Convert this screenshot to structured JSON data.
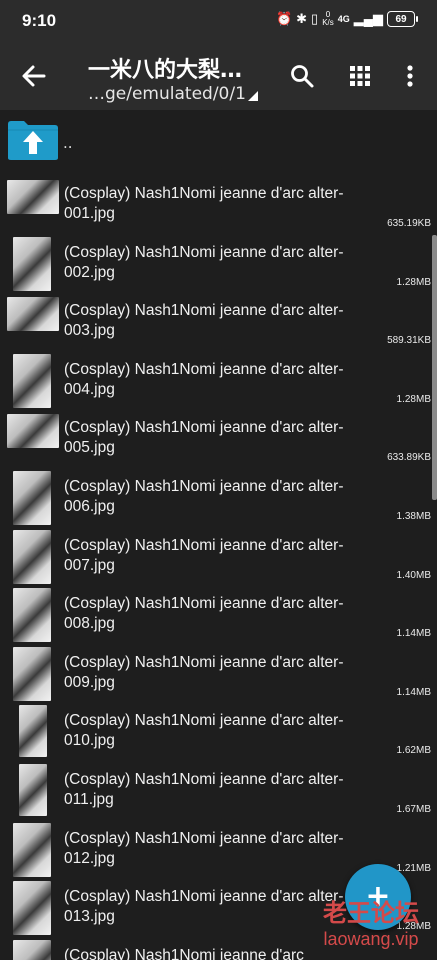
{
  "status_bar": {
    "time": "9:10",
    "net_speed_top": "0",
    "net_speed_bottom": "K/s",
    "signal": "4G",
    "battery": "69"
  },
  "toolbar": {
    "title": "一米八的大梨…",
    "path": "…ge/emulated/0/1"
  },
  "up_item": {
    "label": ".."
  },
  "files": [
    {
      "name": "(Cosplay) Nash1Nomi jeanne d'arc alter-001.jpg",
      "size": "635.19KB",
      "orientation": "landscape"
    },
    {
      "name": "(Cosplay) Nash1Nomi jeanne d'arc alter-002.jpg",
      "size": "1.28MB",
      "orientation": "portrait"
    },
    {
      "name": "(Cosplay) Nash1Nomi jeanne d'arc alter-003.jpg",
      "size": "589.31KB",
      "orientation": "landscape"
    },
    {
      "name": "(Cosplay) Nash1Nomi jeanne d'arc alter-004.jpg",
      "size": "1.28MB",
      "orientation": "portrait"
    },
    {
      "name": "(Cosplay) Nash1Nomi jeanne d'arc alter-005.jpg",
      "size": "633.89KB",
      "orientation": "landscape"
    },
    {
      "name": "(Cosplay) Nash1Nomi jeanne d'arc alter-006.jpg",
      "size": "1.38MB",
      "orientation": "portrait"
    },
    {
      "name": "(Cosplay) Nash1Nomi jeanne d'arc alter-007.jpg",
      "size": "1.40MB",
      "orientation": "portrait"
    },
    {
      "name": "(Cosplay) Nash1Nomi jeanne d'arc alter-008.jpg",
      "size": "1.14MB",
      "orientation": "portrait"
    },
    {
      "name": "(Cosplay) Nash1Nomi jeanne d'arc alter-009.jpg",
      "size": "1.14MB",
      "orientation": "portrait"
    },
    {
      "name": "(Cosplay) Nash1Nomi jeanne d'arc alter-010.jpg",
      "size": "1.62MB",
      "orientation": "portrait-narrow"
    },
    {
      "name": "(Cosplay) Nash1Nomi jeanne d'arc alter-011.jpg",
      "size": "1.67MB",
      "orientation": "portrait-narrow"
    },
    {
      "name": "(Cosplay) Nash1Nomi jeanne d'arc alter-012.jpg",
      "size": "1.21MB",
      "orientation": "portrait"
    },
    {
      "name": "(Cosplay) Nash1Nomi jeanne d'arc alter-013.jpg",
      "size": "1.28MB",
      "orientation": "portrait"
    },
    {
      "name": "(Cosplay) Nash1Nomi jeanne d'arc",
      "size": "",
      "orientation": "portrait"
    }
  ],
  "fab": {
    "label": "+"
  },
  "watermark": {
    "cn": "老王论坛",
    "en": "laowang.vip"
  },
  "colors": {
    "background": "#1e1e1e",
    "toolbar": "#2c2c2c",
    "folder": "#1f9bc9",
    "fab": "#2196c8",
    "watermark": "#d44a4a"
  }
}
